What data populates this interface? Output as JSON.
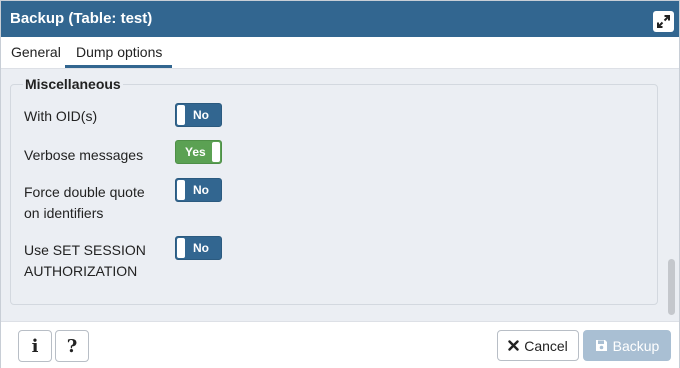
{
  "dialog": {
    "title": "Backup (Table: test)"
  },
  "tabs": [
    {
      "label": "General",
      "active": false
    },
    {
      "label": "Dump options",
      "active": true
    }
  ],
  "section": {
    "legend": "Miscellaneous",
    "rows": [
      {
        "label": "With OID(s)",
        "toggle": "No",
        "state": "off"
      },
      {
        "label": "Verbose messages",
        "toggle": "Yes",
        "state": "on"
      },
      {
        "label_line1": "Force double quote",
        "label_line2": "on identifiers",
        "toggle": "No",
        "state": "off"
      },
      {
        "label_line1": "Use SET SESSION",
        "label_line2": "AUTHORIZATION",
        "toggle": "No",
        "state": "off"
      }
    ]
  },
  "footer": {
    "info_icon": "i",
    "help_icon": "?",
    "cancel_label": "Cancel",
    "backup_label": "Backup"
  },
  "colors": {
    "header": "#326690",
    "toggle_off": "#326690",
    "toggle_on": "#5ba153",
    "backup_disabled": "#a9bfd3"
  }
}
